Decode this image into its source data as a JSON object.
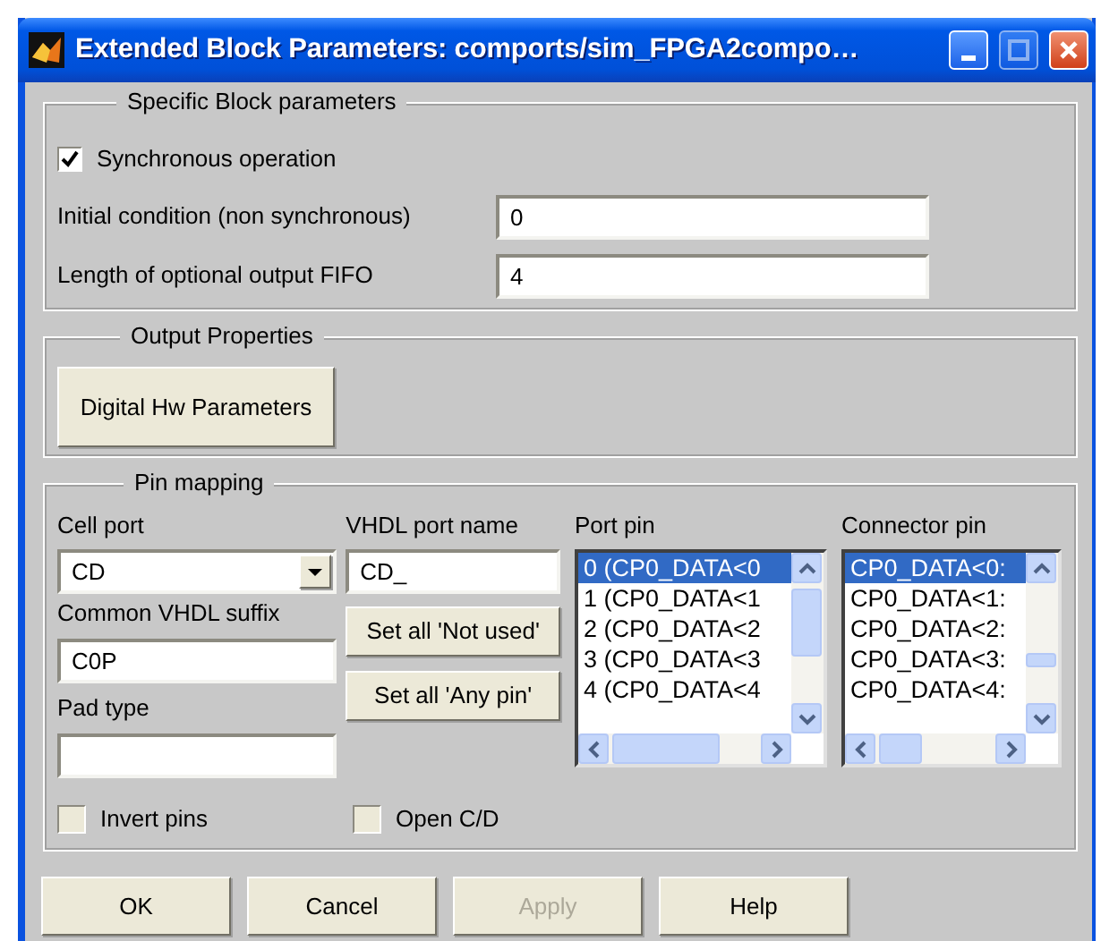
{
  "window": {
    "title": "Extended Block Parameters: comports/sim_FPGA2compo…"
  },
  "specific": {
    "legend": "Specific Block parameters",
    "synchronous": {
      "label": "Synchronous operation",
      "checked": true
    },
    "fields": [
      {
        "label": "Initial condition (non synchronous)",
        "value": "0"
      },
      {
        "label": "Length of optional output FIFO",
        "value": "4"
      }
    ]
  },
  "output": {
    "legend": "Output Properties",
    "button": "Digital Hw Parameters"
  },
  "pin_mapping": {
    "legend": "Pin mapping",
    "cell_port": {
      "label": "Cell port",
      "value": "CD"
    },
    "common_suffix": {
      "label": "Common VHDL suffix",
      "value": "C0P"
    },
    "pad_type": {
      "label": "Pad type"
    },
    "vhdl_port_name": {
      "label": "VHDL port name",
      "value": "CD_"
    },
    "set_buttons": [
      "Set all 'Not used'",
      "Set all 'Any pin'"
    ],
    "port_pin": {
      "label": "Port pin",
      "items": [
        {
          "text": "0 (CP0_DATA<0",
          "selected": true
        },
        {
          "text": "1 (CP0_DATA<1",
          "selected": false
        },
        {
          "text": "2 (CP0_DATA<2",
          "selected": false
        },
        {
          "text": "3 (CP0_DATA<3",
          "selected": false
        },
        {
          "text": "4 (CP0_DATA<4",
          "selected": false
        }
      ]
    },
    "connector_pin": {
      "label": "Connector pin",
      "items": [
        {
          "text": "CP0_DATA<0:",
          "selected": true
        },
        {
          "text": "CP0_DATA<1:",
          "selected": false
        },
        {
          "text": "CP0_DATA<2:",
          "selected": false
        },
        {
          "text": "CP0_DATA<3:",
          "selected": false
        },
        {
          "text": "CP0_DATA<4:",
          "selected": false
        }
      ]
    },
    "checkboxes": [
      {
        "label": "Invert pins",
        "checked": false,
        "disabled": true
      },
      {
        "label": "Open C/D",
        "checked": false,
        "disabled": true
      }
    ]
  },
  "buttons": [
    {
      "label": "OK",
      "disabled": false
    },
    {
      "label": "Cancel",
      "disabled": false
    },
    {
      "label": "Apply",
      "disabled": true
    },
    {
      "label": "Help",
      "disabled": false
    }
  ]
}
